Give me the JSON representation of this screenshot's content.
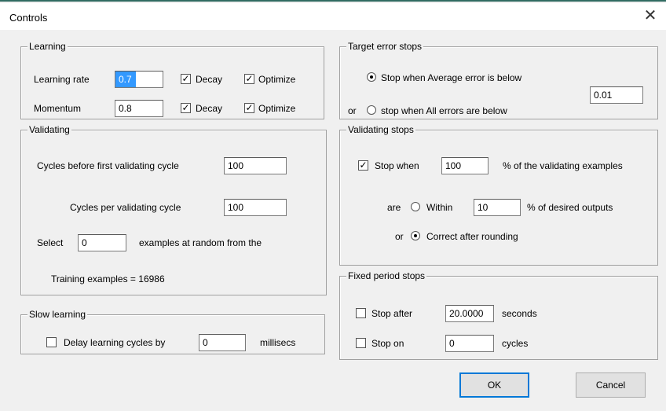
{
  "window": {
    "title": "Controls",
    "close_glyph": "✕"
  },
  "learning": {
    "legend": "Learning",
    "rate_label": "Learning rate",
    "rate_value": "0.7",
    "momentum_label": "Momentum",
    "momentum_value": "0.8",
    "decay_label": "Decay",
    "optimize_label": "Optimize",
    "check_glyph": "✓"
  },
  "validating": {
    "legend": "Validating",
    "cycles_before_label": "Cycles before first validating cycle",
    "cycles_before_value": "100",
    "cycles_per_label": "Cycles per validating cycle",
    "cycles_per_value": "100",
    "select_label": "Select",
    "select_value": "0",
    "select_suffix": "examples at random from the",
    "training_examples": "Training examples = 16986"
  },
  "slow_learning": {
    "legend": "Slow learning",
    "delay_label": "Delay learning cycles by",
    "delay_value": "0",
    "delay_unit": "millisecs"
  },
  "target_error": {
    "legend": "Target error stops",
    "avg_label": "Stop when Average error is below",
    "or_label": "or",
    "all_label": "stop when All errors are below",
    "value": "0.01"
  },
  "validating_stops": {
    "legend": "Validating stops",
    "stop_when_label": "Stop when",
    "stop_when_value": "100",
    "pct_label": "% of the validating examples",
    "are_label": "are",
    "within_label": "Within",
    "within_value": "10",
    "desired_label": "% of desired outputs",
    "or_label": "or",
    "correct_label": "Correct after rounding"
  },
  "fixed_period": {
    "legend": "Fixed period stops",
    "stop_after_label": "Stop after",
    "stop_after_value": "20.0000",
    "seconds_label": "seconds",
    "stop_on_label": "Stop on",
    "stop_on_value": "0",
    "cycles_label": "cycles"
  },
  "buttons": {
    "ok": "OK",
    "cancel": "Cancel"
  }
}
